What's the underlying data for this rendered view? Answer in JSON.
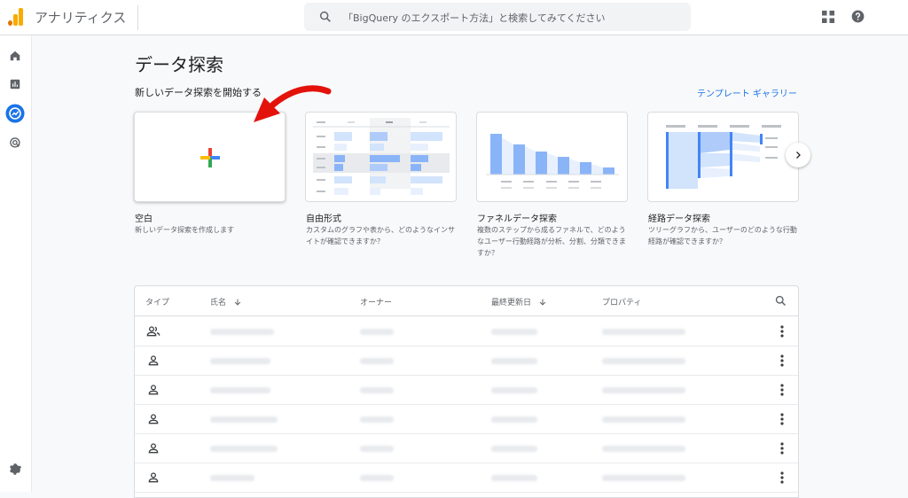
{
  "app": {
    "title": "アナリティクス"
  },
  "search": {
    "placeholder": "「BigQuery のエクスポート方法」と検索してみてください"
  },
  "page": {
    "title": "データ探索",
    "section_label": "新しいデータ探索を開始する",
    "gallery_link": "テンプレート ギャラリー"
  },
  "cards": [
    {
      "title": "空白",
      "desc": "新しいデータ探索を作成します"
    },
    {
      "title": "自由形式",
      "desc": "カスタムのグラフや表から、どのようなインサイトが確認できますか？"
    },
    {
      "title": "ファネルデータ探索",
      "desc": "複数のステップから成るファネルで、どのようなユーザー行動経路が分析、分割、分類できますか？"
    },
    {
      "title": "経路データ探索",
      "desc": "ツリーグラフから、ユーザーのどのような行動経路が確認できますか？"
    }
  ],
  "table": {
    "columns": {
      "type": "タイプ",
      "name": "氏名",
      "owner": "オーナー",
      "updated": "最終更新日",
      "property": "プロパティ"
    },
    "rows": [
      {
        "type_icon": "group-icon"
      },
      {
        "type_icon": "person-icon"
      },
      {
        "type_icon": "person-icon"
      },
      {
        "type_icon": "person-icon"
      },
      {
        "type_icon": "person-icon"
      },
      {
        "type_icon": "person-icon"
      }
    ]
  },
  "colors": {
    "accent": "#1a73e8",
    "rail_active": "#1a73e8",
    "logo_orange": "#f9ab00",
    "logo_dark_orange": "#e37400",
    "plus_blue": "#4285f4",
    "plus_red": "#ea4335",
    "plus_yellow": "#fbbc04",
    "plus_green": "#34a853",
    "arrow_red": "#e3120b"
  }
}
